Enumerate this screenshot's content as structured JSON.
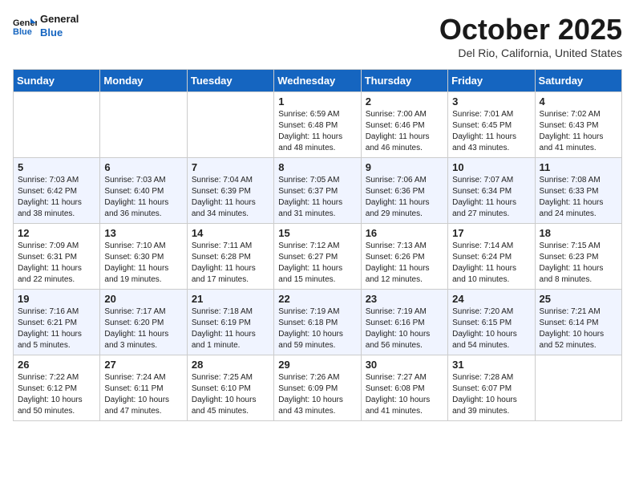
{
  "header": {
    "logo_line1": "General",
    "logo_line2": "Blue",
    "month": "October 2025",
    "location": "Del Rio, California, United States"
  },
  "weekdays": [
    "Sunday",
    "Monday",
    "Tuesday",
    "Wednesday",
    "Thursday",
    "Friday",
    "Saturday"
  ],
  "weeks": [
    [
      {
        "day": "",
        "info": ""
      },
      {
        "day": "",
        "info": ""
      },
      {
        "day": "",
        "info": ""
      },
      {
        "day": "1",
        "info": "Sunrise: 6:59 AM\nSunset: 6:48 PM\nDaylight: 11 hours\nand 48 minutes."
      },
      {
        "day": "2",
        "info": "Sunrise: 7:00 AM\nSunset: 6:46 PM\nDaylight: 11 hours\nand 46 minutes."
      },
      {
        "day": "3",
        "info": "Sunrise: 7:01 AM\nSunset: 6:45 PM\nDaylight: 11 hours\nand 43 minutes."
      },
      {
        "day": "4",
        "info": "Sunrise: 7:02 AM\nSunset: 6:43 PM\nDaylight: 11 hours\nand 41 minutes."
      }
    ],
    [
      {
        "day": "5",
        "info": "Sunrise: 7:03 AM\nSunset: 6:42 PM\nDaylight: 11 hours\nand 38 minutes."
      },
      {
        "day": "6",
        "info": "Sunrise: 7:03 AM\nSunset: 6:40 PM\nDaylight: 11 hours\nand 36 minutes."
      },
      {
        "day": "7",
        "info": "Sunrise: 7:04 AM\nSunset: 6:39 PM\nDaylight: 11 hours\nand 34 minutes."
      },
      {
        "day": "8",
        "info": "Sunrise: 7:05 AM\nSunset: 6:37 PM\nDaylight: 11 hours\nand 31 minutes."
      },
      {
        "day": "9",
        "info": "Sunrise: 7:06 AM\nSunset: 6:36 PM\nDaylight: 11 hours\nand 29 minutes."
      },
      {
        "day": "10",
        "info": "Sunrise: 7:07 AM\nSunset: 6:34 PM\nDaylight: 11 hours\nand 27 minutes."
      },
      {
        "day": "11",
        "info": "Sunrise: 7:08 AM\nSunset: 6:33 PM\nDaylight: 11 hours\nand 24 minutes."
      }
    ],
    [
      {
        "day": "12",
        "info": "Sunrise: 7:09 AM\nSunset: 6:31 PM\nDaylight: 11 hours\nand 22 minutes."
      },
      {
        "day": "13",
        "info": "Sunrise: 7:10 AM\nSunset: 6:30 PM\nDaylight: 11 hours\nand 19 minutes."
      },
      {
        "day": "14",
        "info": "Sunrise: 7:11 AM\nSunset: 6:28 PM\nDaylight: 11 hours\nand 17 minutes."
      },
      {
        "day": "15",
        "info": "Sunrise: 7:12 AM\nSunset: 6:27 PM\nDaylight: 11 hours\nand 15 minutes."
      },
      {
        "day": "16",
        "info": "Sunrise: 7:13 AM\nSunset: 6:26 PM\nDaylight: 11 hours\nand 12 minutes."
      },
      {
        "day": "17",
        "info": "Sunrise: 7:14 AM\nSunset: 6:24 PM\nDaylight: 11 hours\nand 10 minutes."
      },
      {
        "day": "18",
        "info": "Sunrise: 7:15 AM\nSunset: 6:23 PM\nDaylight: 11 hours\nand 8 minutes."
      }
    ],
    [
      {
        "day": "19",
        "info": "Sunrise: 7:16 AM\nSunset: 6:21 PM\nDaylight: 11 hours\nand 5 minutes."
      },
      {
        "day": "20",
        "info": "Sunrise: 7:17 AM\nSunset: 6:20 PM\nDaylight: 11 hours\nand 3 minutes."
      },
      {
        "day": "21",
        "info": "Sunrise: 7:18 AM\nSunset: 6:19 PM\nDaylight: 11 hours\nand 1 minute."
      },
      {
        "day": "22",
        "info": "Sunrise: 7:19 AM\nSunset: 6:18 PM\nDaylight: 10 hours\nand 59 minutes."
      },
      {
        "day": "23",
        "info": "Sunrise: 7:19 AM\nSunset: 6:16 PM\nDaylight: 10 hours\nand 56 minutes."
      },
      {
        "day": "24",
        "info": "Sunrise: 7:20 AM\nSunset: 6:15 PM\nDaylight: 10 hours\nand 54 minutes."
      },
      {
        "day": "25",
        "info": "Sunrise: 7:21 AM\nSunset: 6:14 PM\nDaylight: 10 hours\nand 52 minutes."
      }
    ],
    [
      {
        "day": "26",
        "info": "Sunrise: 7:22 AM\nSunset: 6:12 PM\nDaylight: 10 hours\nand 50 minutes."
      },
      {
        "day": "27",
        "info": "Sunrise: 7:24 AM\nSunset: 6:11 PM\nDaylight: 10 hours\nand 47 minutes."
      },
      {
        "day": "28",
        "info": "Sunrise: 7:25 AM\nSunset: 6:10 PM\nDaylight: 10 hours\nand 45 minutes."
      },
      {
        "day": "29",
        "info": "Sunrise: 7:26 AM\nSunset: 6:09 PM\nDaylight: 10 hours\nand 43 minutes."
      },
      {
        "day": "30",
        "info": "Sunrise: 7:27 AM\nSunset: 6:08 PM\nDaylight: 10 hours\nand 41 minutes."
      },
      {
        "day": "31",
        "info": "Sunrise: 7:28 AM\nSunset: 6:07 PM\nDaylight: 10 hours\nand 39 minutes."
      },
      {
        "day": "",
        "info": ""
      }
    ]
  ]
}
